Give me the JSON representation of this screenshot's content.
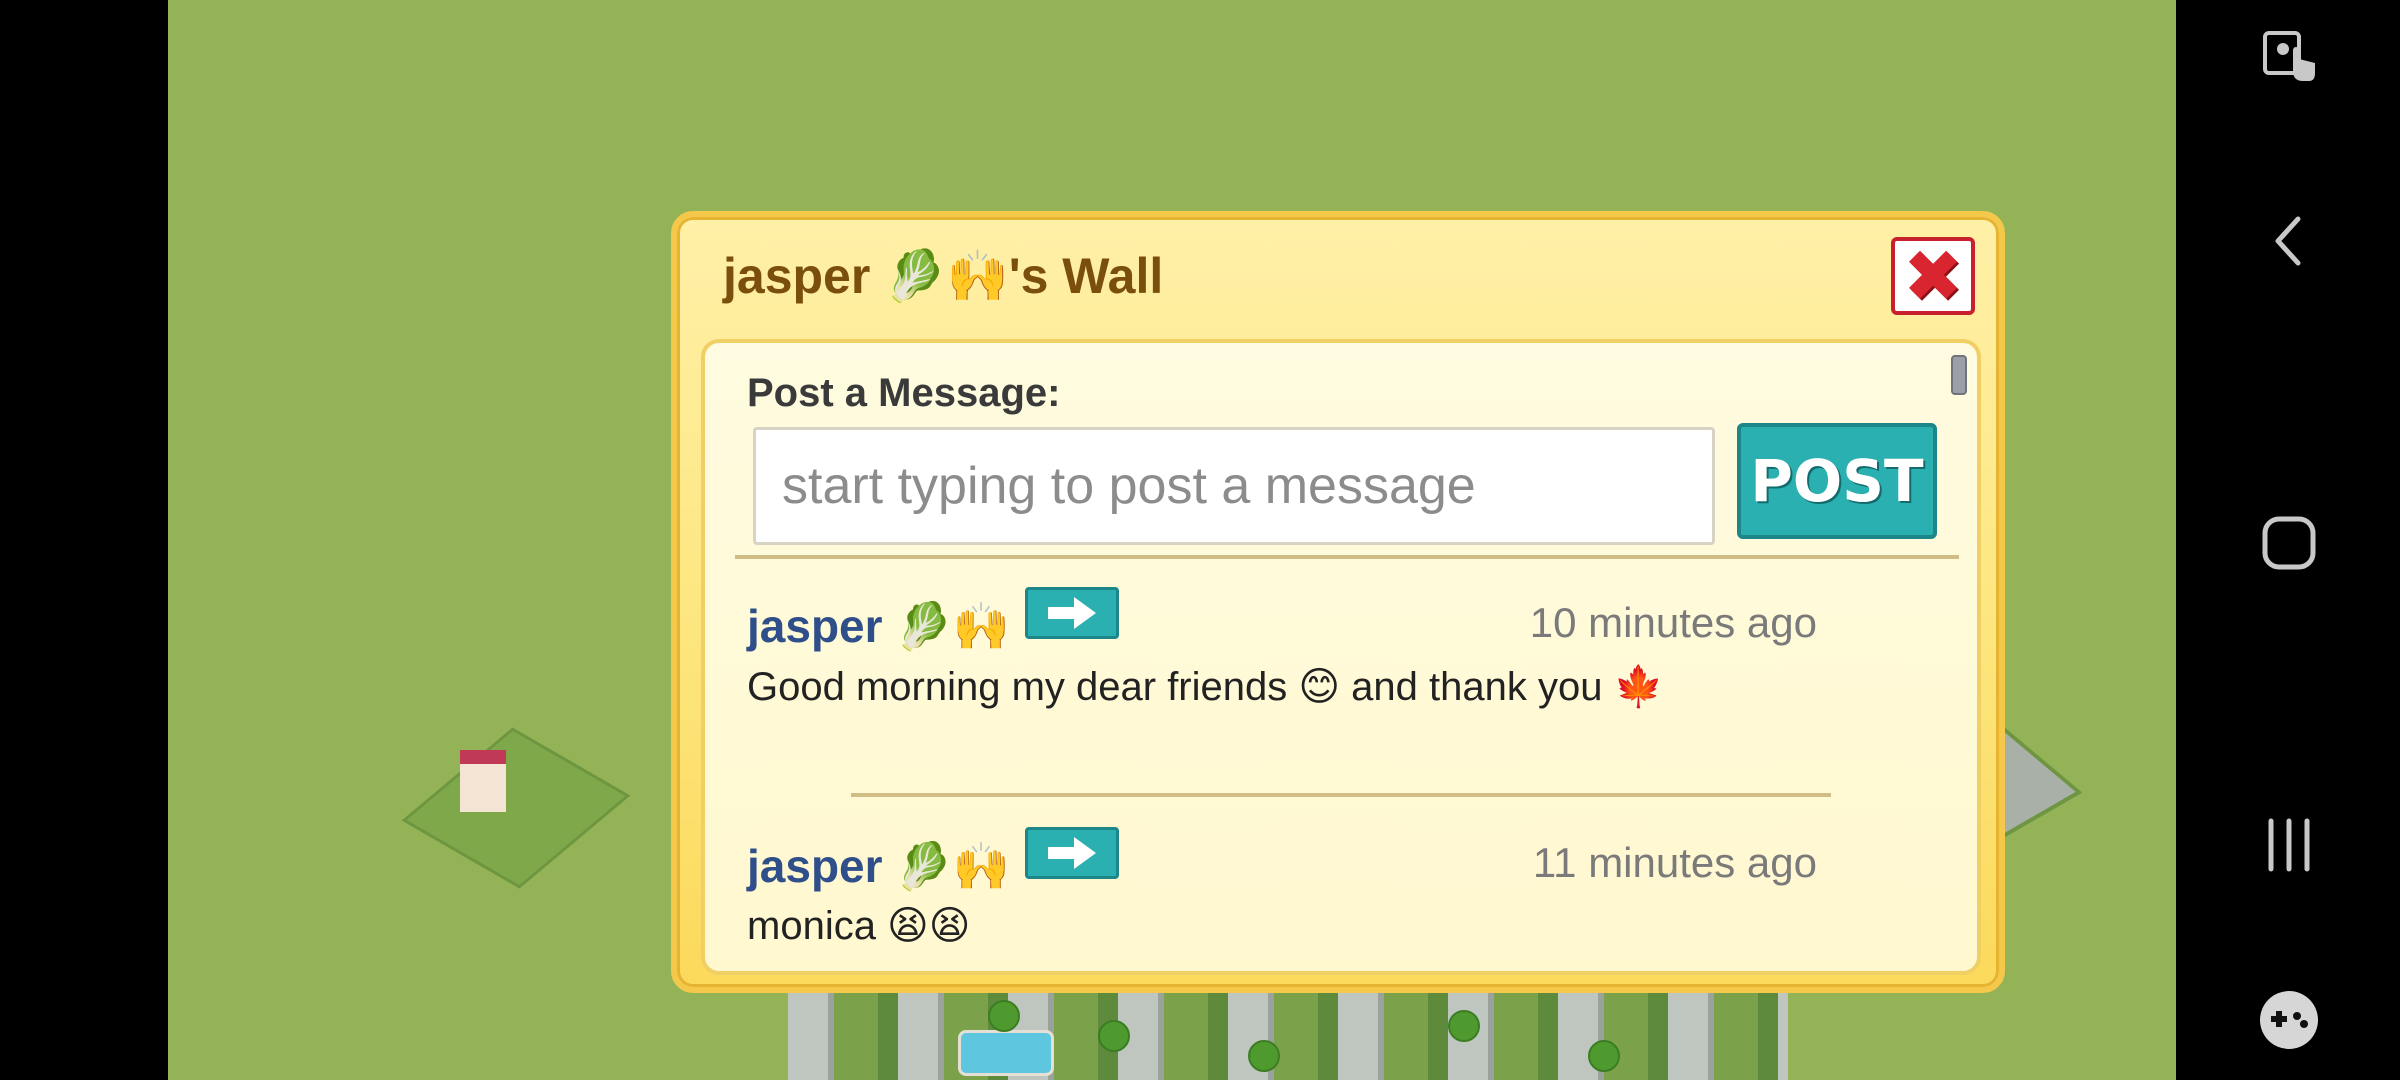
{
  "dialog": {
    "title": "jasper 🥬🙌's Wall",
    "close_label": "✖",
    "post_heading": "Post a Message:",
    "input_value": "",
    "input_placeholder": "start typing to post a message",
    "post_button_label": "POST"
  },
  "posts": [
    {
      "author": "jasper 🥬🙌",
      "time": "10 minutes ago",
      "message": "Good morning my dear friends 😊 and thank you 🍁"
    },
    {
      "author": "jasper 🥬🙌",
      "time": "11 minutes ago",
      "message": "monica 😫😫"
    }
  ],
  "icons": {
    "go_button": "arrow-right-icon",
    "screenshot_tool": "touch-icon",
    "back": "chevron-left-icon",
    "home": "home-icon",
    "recents": "recents-icon",
    "game_tools": "gamepad-icon"
  },
  "colors": {
    "game_background": "#93b356",
    "dialog_fill": "#fde781",
    "content_fill": "#fffbe0",
    "title_text": "#7a4e0c",
    "author_text": "#2f4f8a",
    "accent_teal": "#2ab0b0",
    "close_red": "#d9252f"
  }
}
